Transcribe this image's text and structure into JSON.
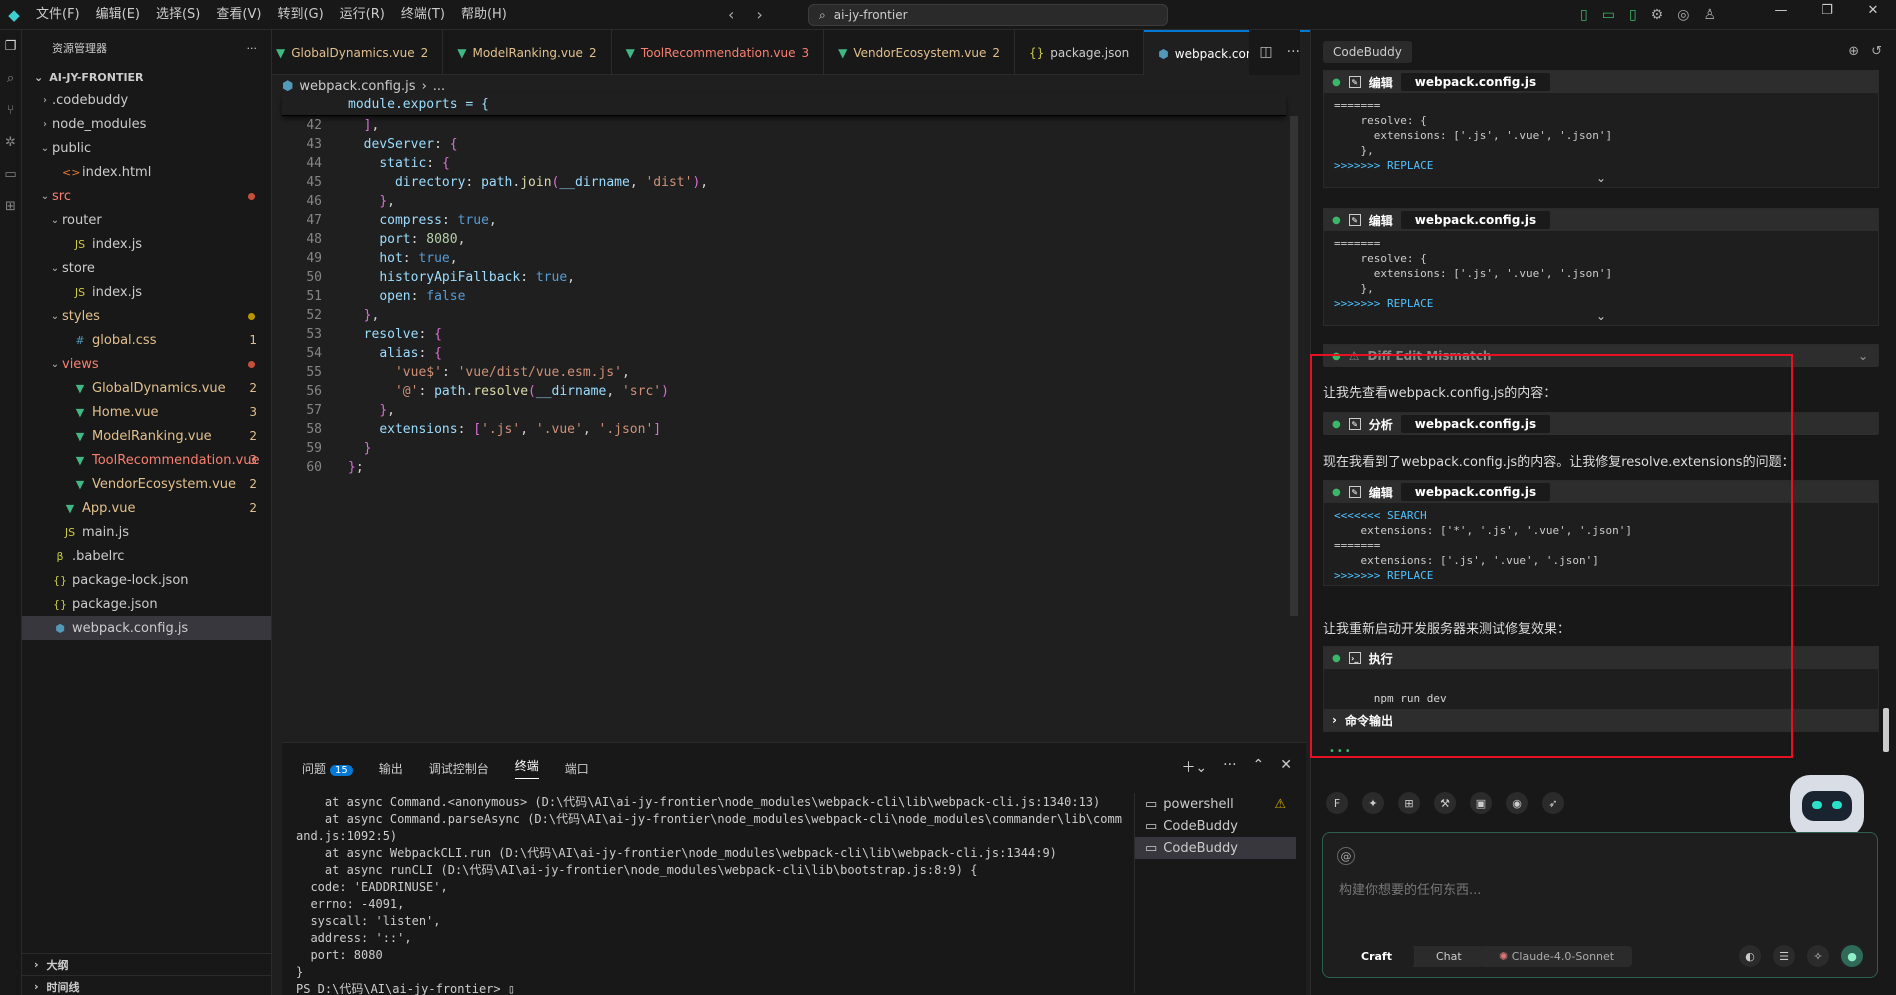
{
  "menu": [
    "文件(F)",
    "编辑(E)",
    "选择(S)",
    "查看(V)",
    "转到(G)",
    "运行(R)",
    "终端(T)",
    "帮助(H)"
  ],
  "search": {
    "value": "ai-jy-frontier"
  },
  "explorer": {
    "title": "资源管理器",
    "root": "AI-JY-FRONTIER",
    "items": [
      {
        "label": ".codebuddy",
        "depth": 1,
        "kind": "folder",
        "open": false
      },
      {
        "label": "node_modules",
        "depth": 1,
        "kind": "folder",
        "open": false
      },
      {
        "label": "public",
        "depth": 1,
        "kind": "folder",
        "open": true
      },
      {
        "label": "index.html",
        "depth": 2,
        "kind": "html"
      },
      {
        "label": "src",
        "depth": 1,
        "kind": "folder",
        "open": true,
        "dot": "#c74e39",
        "color": "#f88070"
      },
      {
        "label": "router",
        "depth": 2,
        "kind": "folder",
        "open": true
      },
      {
        "label": "index.js",
        "depth": 3,
        "kind": "js"
      },
      {
        "label": "store",
        "depth": 2,
        "kind": "folder",
        "open": true
      },
      {
        "label": "index.js",
        "depth": 3,
        "kind": "js"
      },
      {
        "label": "styles",
        "depth": 2,
        "kind": "folder",
        "open": true,
        "dot": "#b89500",
        "color": "#e2c08d"
      },
      {
        "label": "global.css",
        "depth": 3,
        "kind": "css",
        "badge": "1",
        "color": "#e2c08d"
      },
      {
        "label": "views",
        "depth": 2,
        "kind": "folder",
        "open": true,
        "dot": "#c74e39",
        "color": "#f88070"
      },
      {
        "label": "GlobalDynamics.vue",
        "depth": 3,
        "kind": "vue",
        "badge": "2",
        "color": "#e2c08d"
      },
      {
        "label": "Home.vue",
        "depth": 3,
        "kind": "vue",
        "badge": "3",
        "color": "#e2c08d"
      },
      {
        "label": "ModelRanking.vue",
        "depth": 3,
        "kind": "vue",
        "badge": "2",
        "color": "#e2c08d"
      },
      {
        "label": "ToolRecommendation.vue",
        "depth": 3,
        "kind": "vue",
        "badge": "3",
        "color": "#f88070"
      },
      {
        "label": "VendorEcosystem.vue",
        "depth": 3,
        "kind": "vue",
        "badge": "2",
        "color": "#e2c08d"
      },
      {
        "label": "App.vue",
        "depth": 2,
        "kind": "vue",
        "badge": "2",
        "color": "#e2c08d"
      },
      {
        "label": "main.js",
        "depth": 2,
        "kind": "js"
      },
      {
        "label": ".babelrc",
        "depth": 1,
        "kind": "babel"
      },
      {
        "label": "package-lock.json",
        "depth": 1,
        "kind": "json"
      },
      {
        "label": "package.json",
        "depth": 1,
        "kind": "json"
      },
      {
        "label": "webpack.config.js",
        "depth": 1,
        "kind": "webpack",
        "selected": true
      }
    ],
    "outline": "大纲",
    "timeline": "时间线"
  },
  "tabs": [
    {
      "label": "GlobalDynamics.vue",
      "badge": "2",
      "color": "#e2c08d"
    },
    {
      "label": "ModelRanking.vue",
      "badge": "2",
      "color": "#e2c08d"
    },
    {
      "label": "ToolRecommendation.vue",
      "badge": "3",
      "color": "#f88070"
    },
    {
      "label": "VendorEcosystem.vue",
      "badge": "2",
      "color": "#e2c08d"
    },
    {
      "label": "package.json",
      "badge": "",
      "color": "#cccccc"
    },
    {
      "label": "webpack.config.js",
      "badge": "",
      "color": "#ffffff",
      "active": true
    }
  ],
  "breadcrumb": {
    "file": "webpack.config.js",
    "rest": "..."
  },
  "sticky": "module.exports = {",
  "code_lines": [
    {
      "n": "42",
      "t": "  ],"
    },
    {
      "n": "43",
      "t": "  devServer: {"
    },
    {
      "n": "44",
      "t": "    static: {"
    },
    {
      "n": "45",
      "t": "      directory: path.join(__dirname, 'dist'),"
    },
    {
      "n": "46",
      "t": "    },"
    },
    {
      "n": "47",
      "t": "    compress: true,"
    },
    {
      "n": "48",
      "t": "    port: 8080,"
    },
    {
      "n": "49",
      "t": "    hot: true,"
    },
    {
      "n": "50",
      "t": "    historyApiFallback: true,"
    },
    {
      "n": "51",
      "t": "    open: false"
    },
    {
      "n": "52",
      "t": "  },"
    },
    {
      "n": "53",
      "t": "  resolve: {"
    },
    {
      "n": "54",
      "t": "    alias: {"
    },
    {
      "n": "55",
      "t": "      'vue$': 'vue/dist/vue.esm.js',"
    },
    {
      "n": "56",
      "t": "      '@': path.resolve(__dirname, 'src')"
    },
    {
      "n": "57",
      "t": "    },"
    },
    {
      "n": "58",
      "t": "    extensions: ['.js', '.vue', '.json']"
    },
    {
      "n": "59",
      "t": "  }"
    },
    {
      "n": "60",
      "t": "};"
    }
  ],
  "panel": {
    "tabs": [
      "问题",
      "输出",
      "调试控制台",
      "终端",
      "端口"
    ],
    "problem_count": "15",
    "active_tab": "终端",
    "terminal_lines": [
      "    at async Command.<anonymous> (D:\\代码\\AI\\ai-jy-frontier\\node_modules\\webpack-cli\\lib\\webpack-cli.js:1340:13)",
      "    at async Command.parseAsync (D:\\代码\\AI\\ai-jy-frontier\\node_modules\\webpack-cli\\node_modules\\commander\\lib\\comm",
      "and.js:1092:5)",
      "    at async WebpackCLI.run (D:\\代码\\AI\\ai-jy-frontier\\node_modules\\webpack-cli\\lib\\webpack-cli.js:1344:9)",
      "    at async runCLI (D:\\代码\\AI\\ai-jy-frontier\\node_modules\\webpack-cli\\lib\\bootstrap.js:8:9) {",
      "  code: 'EADDRINUSE',",
      "  errno: -4091,",
      "  syscall: 'listen',",
      "  address: '::',",
      "  port: 8080",
      "}",
      "PS D:\\代码\\AI\\ai-jy-frontier> "
    ],
    "terminals": [
      "powershell",
      "CodeBuddy",
      "CodeBuddy"
    ]
  },
  "codebuddy": {
    "tab": "CodeBuddy",
    "card1": {
      "action": "编辑",
      "file": "webpack.config.js",
      "lines": [
        "=======",
        "    resolve: {",
        "      extensions: ['.js', '.vue', '.json']",
        "    },",
        ">>>>>>> REPLACE"
      ]
    },
    "card2": {
      "action": "编辑",
      "file": "webpack.config.js",
      "lines": [
        "=======",
        "    resolve: {",
        "      extensions: ['.js', '.vue', '.json']",
        "    },",
        ">>>>>>> REPLACE"
      ]
    },
    "mismatch": "Diff Edit Mismatch",
    "msg1": "让我先查看webpack.config.js的内容：",
    "card3": {
      "action": "分析",
      "file": "webpack.config.js"
    },
    "msg2": "现在我看到了webpack.config.js的内容。让我修复resolve.extensions的问题：",
    "card4": {
      "action": "编辑",
      "file": "webpack.config.js",
      "lines": [
        "<<<<<<< SEARCH",
        "    extensions: ['*', '.js', '.vue', '.json']",
        "=======",
        "    extensions: ['.js', '.vue', '.json']",
        ">>>>>>> REPLACE"
      ]
    },
    "msg3": "让我重新启动开发服务器来测试修复效果：",
    "card5": {
      "action": "执行",
      "command": "npm run dev",
      "output_label": "命令输出"
    },
    "input_placeholder": "构建你想要的任何东西...",
    "modes": [
      "Craft",
      "Chat"
    ],
    "model": "Claude-4.0-Sonnet"
  },
  "colors": {
    "accent": "#0078d4",
    "highlight_box": "#e81123",
    "vue": "#41b883"
  }
}
